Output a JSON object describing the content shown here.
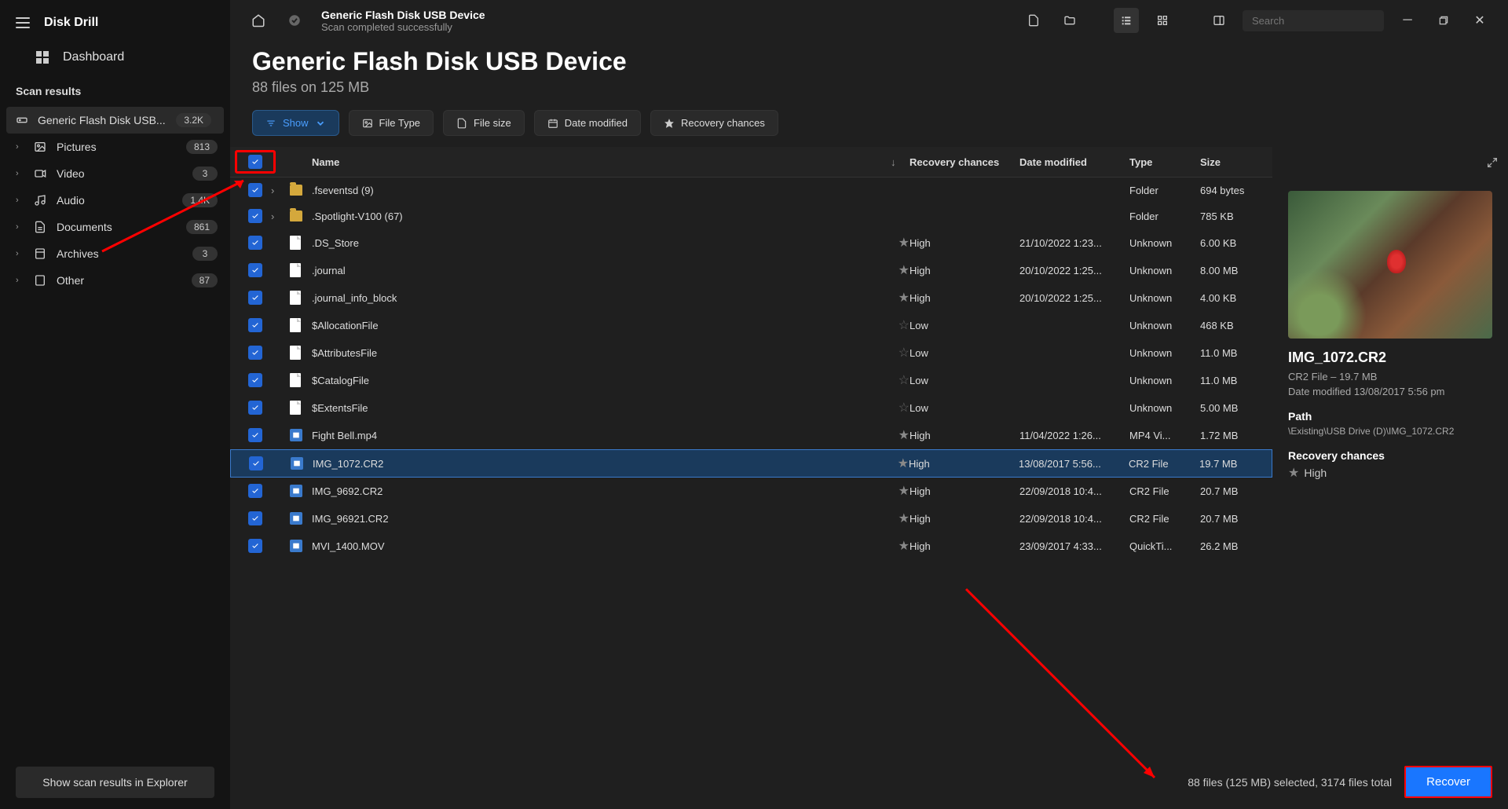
{
  "app": {
    "title": "Disk Drill"
  },
  "sidebar": {
    "dashboard": "Dashboard",
    "scan_results_label": "Scan results",
    "device_item": {
      "label": "Generic Flash Disk USB...",
      "badge": "3.2K"
    },
    "categories": [
      {
        "label": "Pictures",
        "badge": "813"
      },
      {
        "label": "Video",
        "badge": "3"
      },
      {
        "label": "Audio",
        "badge": "1.4K"
      },
      {
        "label": "Documents",
        "badge": "861"
      },
      {
        "label": "Archives",
        "badge": "3"
      },
      {
        "label": "Other",
        "badge": "87"
      }
    ],
    "explorer_btn": "Show scan results in Explorer"
  },
  "topbar": {
    "title": "Generic Flash Disk USB Device",
    "subtitle": "Scan completed successfully",
    "search_placeholder": "Search"
  },
  "header": {
    "title": "Generic Flash Disk USB Device",
    "subtitle": "88 files on 125 MB"
  },
  "filters": {
    "show": "Show",
    "file_type": "File Type",
    "file_size": "File size",
    "date_modified": "Date modified",
    "recovery_chances": "Recovery chances"
  },
  "columns": {
    "name": "Name",
    "recovery": "Recovery chances",
    "date": "Date modified",
    "type": "Type",
    "size": "Size"
  },
  "rows": [
    {
      "expand": true,
      "folder": true,
      "name": ".fseventsd (9)",
      "recovery": "",
      "star": "",
      "date": "",
      "type": "Folder",
      "size": "694 bytes"
    },
    {
      "expand": true,
      "folder": true,
      "name": ".Spotlight-V100 (67)",
      "recovery": "",
      "star": "",
      "date": "",
      "type": "Folder",
      "size": "785 KB"
    },
    {
      "doc": true,
      "name": ".DS_Store",
      "recovery": "High",
      "star": "fill",
      "date": "21/10/2022 1:23...",
      "type": "Unknown",
      "size": "6.00 KB"
    },
    {
      "doc": true,
      "name": ".journal",
      "recovery": "High",
      "star": "fill",
      "date": "20/10/2022 1:25...",
      "type": "Unknown",
      "size": "8.00 MB"
    },
    {
      "doc": true,
      "name": ".journal_info_block",
      "recovery": "High",
      "star": "fill",
      "date": "20/10/2022 1:25...",
      "type": "Unknown",
      "size": "4.00 KB"
    },
    {
      "doc": true,
      "name": "$AllocationFile",
      "recovery": "Low",
      "star": "outline",
      "date": "",
      "type": "Unknown",
      "size": "468 KB"
    },
    {
      "doc": true,
      "name": "$AttributesFile",
      "recovery": "Low",
      "star": "outline",
      "date": "",
      "type": "Unknown",
      "size": "11.0 MB"
    },
    {
      "doc": true,
      "name": "$CatalogFile",
      "recovery": "Low",
      "star": "outline",
      "date": "",
      "type": "Unknown",
      "size": "11.0 MB"
    },
    {
      "doc": true,
      "name": "$ExtentsFile",
      "recovery": "Low",
      "star": "outline",
      "date": "",
      "type": "Unknown",
      "size": "5.00 MB"
    },
    {
      "img": true,
      "name": "Fight Bell.mp4",
      "recovery": "High",
      "star": "fill",
      "date": "11/04/2022 1:26...",
      "type": "MP4 Vi...",
      "size": "1.72 MB"
    },
    {
      "img": true,
      "selected": true,
      "name": "IMG_1072.CR2",
      "recovery": "High",
      "star": "fill",
      "date": "13/08/2017 5:56...",
      "type": "CR2 File",
      "size": "19.7 MB"
    },
    {
      "img": true,
      "name": "IMG_9692.CR2",
      "recovery": "High",
      "star": "fill",
      "date": "22/09/2018 10:4...",
      "type": "CR2 File",
      "size": "20.7 MB"
    },
    {
      "img": true,
      "name": "IMG_96921.CR2",
      "recovery": "High",
      "star": "fill",
      "date": "22/09/2018 10:4...",
      "type": "CR2 File",
      "size": "20.7 MB"
    },
    {
      "img": true,
      "name": "MVI_1400.MOV",
      "recovery": "High",
      "star": "fill",
      "date": "23/09/2017 4:33...",
      "type": "QuickTi...",
      "size": "26.2 MB"
    }
  ],
  "preview": {
    "title": "IMG_1072.CR2",
    "meta1": "CR2 File – 19.7 MB",
    "meta2": "Date modified 13/08/2017 5:56 pm",
    "path_label": "Path",
    "path": "\\Existing\\USB Drive (D)\\IMG_1072.CR2",
    "rc_label": "Recovery chances",
    "rc_value": "High"
  },
  "footer": {
    "status": "88 files (125 MB) selected, 3174 files total",
    "recover": "Recover"
  }
}
